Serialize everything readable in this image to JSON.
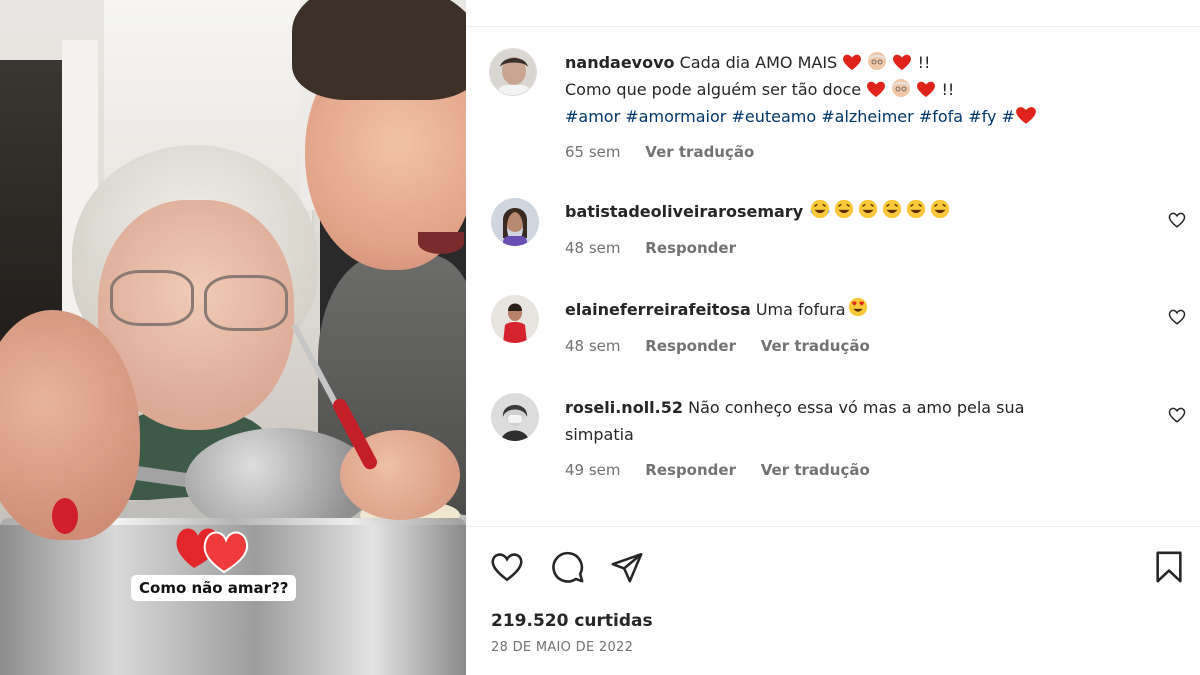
{
  "media": {
    "overlay_caption": "Como não amar??",
    "sticker_icon": "hearts-sticker-icon"
  },
  "caption": {
    "username": "nandaevovo",
    "line1_text": "Cada dia AMO MAIS",
    "line1_suffix": "!!",
    "line2_text": "Como que pode alguém ser tão doce",
    "line2_suffix": "!!",
    "hashtags": [
      "#amor",
      "#amormaior",
      "#euteamo",
      "#alzheimer",
      "#fofa",
      "#fy",
      "#"
    ],
    "time": "65 sem",
    "translate": "Ver tradução"
  },
  "comments": [
    {
      "username": "batistadeoliveirarosemary",
      "text": "",
      "emoji_count": 6,
      "emoji": "laughing-tears",
      "time": "48 sem",
      "reply": "Responder",
      "translate": ""
    },
    {
      "username": "elaineferreirafeitosa",
      "text": "Uma fofura",
      "emoji_count": 1,
      "emoji": "heart-eyes",
      "time": "48 sem",
      "reply": "Responder",
      "translate": "Ver tradução"
    },
    {
      "username": "roseli.noll.52",
      "text": "Não conheço essa vó mas a amo pela sua",
      "text_line2": "simpatia",
      "emoji_count": 0,
      "emoji": "",
      "time": "49 sem",
      "reply": "Responder",
      "translate": "Ver tradução"
    }
  ],
  "actions": {
    "like_icon": "heart-icon",
    "comment_icon": "comment-icon",
    "share_icon": "share-icon",
    "save_icon": "bookmark-icon"
  },
  "likes": "219.520 curtidas",
  "date": "28 DE MAIO DE 2022",
  "colors": {
    "text": "#262626",
    "secondary": "#737373",
    "hashtag": "#00376b",
    "heart_red": "#e0241b"
  }
}
